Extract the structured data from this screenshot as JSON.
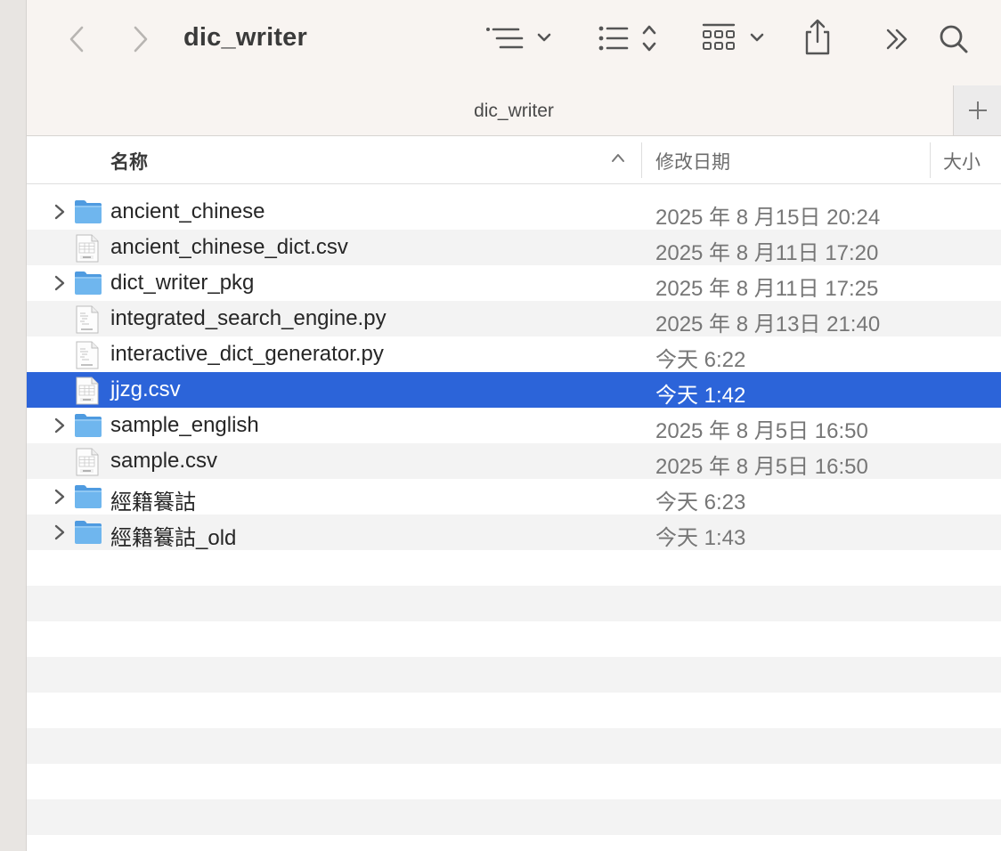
{
  "window": {
    "title": "dic_writer",
    "tab_label": "dic_writer"
  },
  "toolbar": {
    "back_icon": "chevron-left-icon",
    "forward_icon": "chevron-right-icon",
    "group_icon": "group-list-icon",
    "view_icon": "list-view-icon",
    "gallery_icon": "icon-grid-icon",
    "share_icon": "share-icon",
    "more_icon": "double-chevron-right-icon",
    "search_icon": "search-icon",
    "new_tab_label": "+"
  },
  "columns": {
    "name": "名称",
    "date": "修改日期",
    "size": "大小"
  },
  "files": [
    {
      "name": "ancient_chinese",
      "date": "2025 年 8 月15日 20:24",
      "kind": "folder"
    },
    {
      "name": "ancient_chinese_dict.csv",
      "date": "2025 年 8 月11日 17:20",
      "kind": "csv"
    },
    {
      "name": "dict_writer_pkg",
      "date": "2025 年 8 月11日 17:25",
      "kind": "folder"
    },
    {
      "name": "integrated_search_engine.py",
      "date": "2025 年 8 月13日 21:40",
      "kind": "python"
    },
    {
      "name": "interactive_dict_generator.py",
      "date": "今天 6:22",
      "kind": "python"
    },
    {
      "name": "jjzg.csv",
      "date": "今天 1:42",
      "kind": "csv",
      "selected": true
    },
    {
      "name": "sample_english",
      "date": "2025 年 8 月5日 16:50",
      "kind": "folder"
    },
    {
      "name": "sample.csv",
      "date": "2025 年 8 月5日 16:50",
      "kind": "csv"
    },
    {
      "name": "經籍籑詁",
      "date": "今天 6:23",
      "kind": "folder"
    },
    {
      "name": "經籍籑詁_old",
      "date": "今天 1:43",
      "kind": "folder"
    }
  ],
  "colors": {
    "selection": "#2c64d9",
    "folder": "#6fb6ee",
    "toolbar_bg": "#f8f4f1"
  }
}
